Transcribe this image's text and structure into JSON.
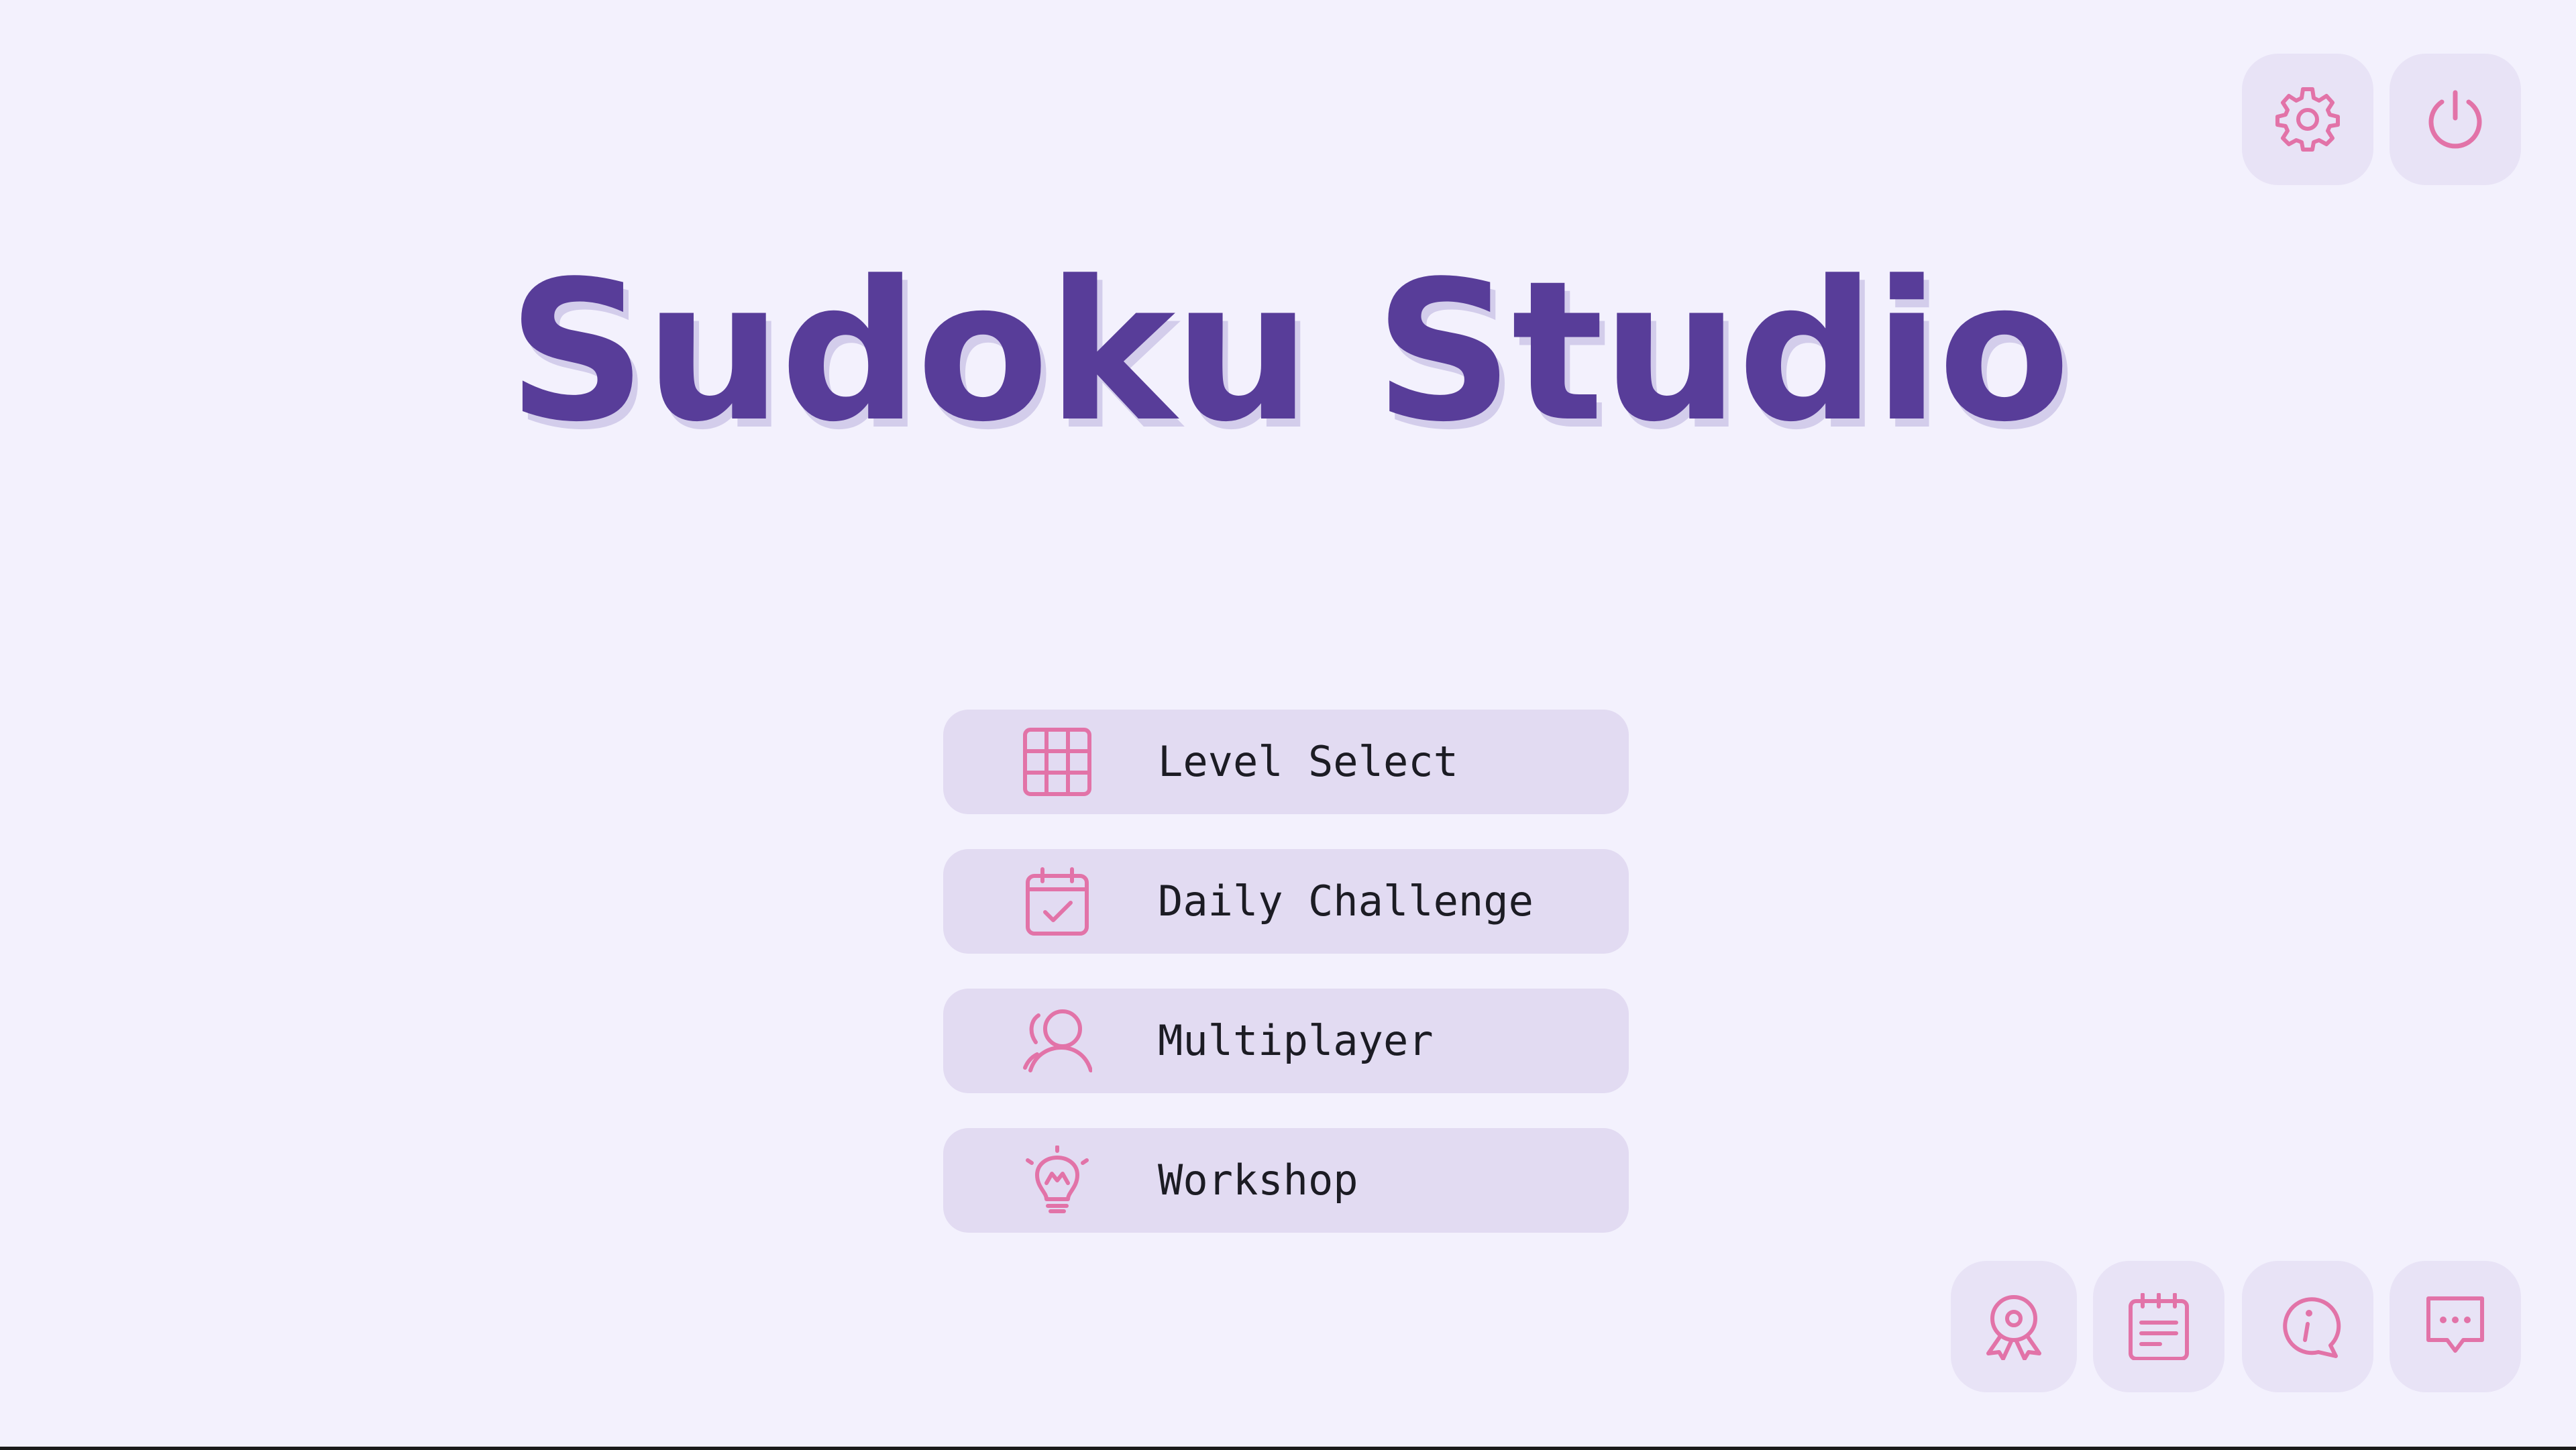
{
  "app": {
    "title": "Sudoku Studio"
  },
  "colors": {
    "background": "#f3f1fd",
    "title": "#583d99",
    "title_shadow": "#d3cdeb",
    "button_bg": "#e2dbf2",
    "corner_button_bg": "#e8e3f6",
    "icon": "#e273a8",
    "label": "#1c1c24"
  },
  "top_actions": [
    {
      "id": "settings",
      "icon": "gear-icon"
    },
    {
      "id": "power",
      "icon": "power-icon"
    }
  ],
  "menu": [
    {
      "id": "level-select",
      "label": "Level Select",
      "icon": "grid-icon"
    },
    {
      "id": "daily-challenge",
      "label": "Daily Challenge",
      "icon": "calendar-check-icon"
    },
    {
      "id": "multiplayer",
      "label": "Multiplayer",
      "icon": "users-icon"
    },
    {
      "id": "workshop",
      "label": "Workshop",
      "icon": "lightbulb-icon"
    }
  ],
  "bottom_actions": [
    {
      "id": "achievements",
      "icon": "award-icon"
    },
    {
      "id": "notes",
      "icon": "notepad-icon"
    },
    {
      "id": "info",
      "icon": "info-bubble-icon"
    },
    {
      "id": "feedback",
      "icon": "chat-bubble-icon"
    }
  ]
}
